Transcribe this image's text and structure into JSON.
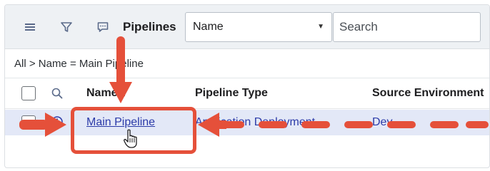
{
  "toolbar": {
    "menu_icon": "hamburger-menu-icon",
    "filter_icon": "filter-funnel-icon",
    "comment_icon": "comment-bubble-icon",
    "title": "Pipelines",
    "field_select": {
      "value": "Name"
    },
    "search": {
      "placeholder": "Search"
    }
  },
  "breadcrumb": "All > Name = Main Pipeline",
  "table": {
    "columns": [
      "Name",
      "Pipeline Type",
      "Source Environment"
    ],
    "sort_indicator": "▲",
    "rows": [
      {
        "name": "Main Pipeline",
        "pipeline_type": "Application Deployment",
        "source_environment": "Dev"
      }
    ]
  },
  "annotation": {
    "color": "#e5503a",
    "cursor_icon": "hand-pointer-cursor-icon"
  }
}
